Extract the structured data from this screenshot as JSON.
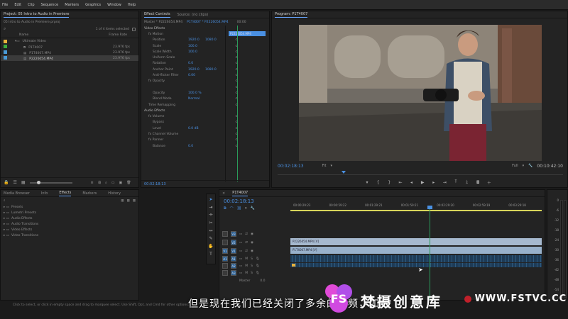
{
  "menu": [
    "File",
    "Edit",
    "Clip",
    "Sequence",
    "Markers",
    "Graphics",
    "Window",
    "Help"
  ],
  "project": {
    "title": "Project: 05 Intro to Audio in Premiere",
    "path": "05 Intro to Audio in Premiere.prproj",
    "count": "1 of 4 items selected",
    "col_name": "Name",
    "col_rate": "Frame Rate",
    "items": [
      {
        "name": "Ultimate Video",
        "rate": "",
        "color": "#e8b13a"
      },
      {
        "name": "P1T4007",
        "rate": "23.976 fps",
        "color": "#3dac3c"
      },
      {
        "name": "P1T4007.MP4",
        "rate": "23.976 fps",
        "color": "#4a9ad6"
      },
      {
        "name": "P2226054.MP4",
        "rate": "23.976 fps",
        "color": "#4a9ad6"
      }
    ]
  },
  "effects_panel": {
    "tabs": [
      "Effect Controls",
      "Source: (no clips)"
    ],
    "master": "Master * P2226054.MP4",
    "seq": "P1T4007 * P2226054.MP4",
    "timecode_top": "00:00",
    "clip_label": "P2226054.MP4",
    "sections": [
      {
        "label": "Video Effects",
        "indent": 0,
        "value": "",
        "value2": ""
      },
      {
        "label": "fx  Motion",
        "indent": 1,
        "value": "",
        "value2": ""
      },
      {
        "label": "Position",
        "indent": 2,
        "value": "1920.0",
        "value2": "1080.0"
      },
      {
        "label": "Scale",
        "indent": 2,
        "value": "100.0",
        "value2": ""
      },
      {
        "label": "Scale Width",
        "indent": 2,
        "value": "100.0",
        "value2": ""
      },
      {
        "label": "Uniform Scale",
        "indent": 2,
        "value": "",
        "value2": ""
      },
      {
        "label": "Rotation",
        "indent": 2,
        "value": "0.0",
        "value2": ""
      },
      {
        "label": "Anchor Point",
        "indent": 2,
        "value": "1920.0",
        "value2": "1080.0"
      },
      {
        "label": "Anti-flicker Filter",
        "indent": 2,
        "value": "0.00",
        "value2": ""
      },
      {
        "label": "fx  Opacity",
        "indent": 1,
        "value": "",
        "value2": ""
      },
      {
        "label": "",
        "indent": 2,
        "value": "",
        "value2": ""
      },
      {
        "label": "Opacity",
        "indent": 2,
        "value": "100.0 %",
        "value2": ""
      },
      {
        "label": "Blend Mode",
        "indent": 2,
        "value": "Normal",
        "value2": ""
      },
      {
        "label": "Time Remapping",
        "indent": 1,
        "value": "",
        "value2": ""
      },
      {
        "label": "Audio Effects",
        "indent": 0,
        "value": "",
        "value2": ""
      },
      {
        "label": "fx  Volume",
        "indent": 1,
        "value": "",
        "value2": ""
      },
      {
        "label": "Bypass",
        "indent": 2,
        "value": "",
        "value2": ""
      },
      {
        "label": "Level",
        "indent": 2,
        "value": "0.0 dB",
        "value2": ""
      },
      {
        "label": "fx  Channel Volume",
        "indent": 1,
        "value": "",
        "value2": ""
      },
      {
        "label": "fx  Panner",
        "indent": 1,
        "value": "",
        "value2": ""
      },
      {
        "label": "Balance",
        "indent": 2,
        "value": "0.0",
        "value2": ""
      }
    ],
    "footer_timecode": "00:02:18:13"
  },
  "program": {
    "title": "Program: P1T4007",
    "timecode": "00:02:18:13",
    "fit": "Fit",
    "quality": "Full",
    "duration": "00:10:42:10"
  },
  "media_browser": {
    "tabs": [
      "Media Browser",
      "Info",
      "Effects",
      "Markers",
      "History"
    ],
    "items": [
      "Presets",
      "Lumetri Presets",
      "Audio Effects",
      "Audio Transitions",
      "Video Effects",
      "Video Transitions"
    ]
  },
  "timeline": {
    "tab": "P1T4007",
    "timecode": "00:02:18:13",
    "ruler": [
      "00:00:29:23",
      "00:00:59:22",
      "00:01:29:21",
      "00:01:59:21",
      "00:02:29:20",
      "00:02:59:19",
      "00:03:29:18"
    ],
    "tracks": [
      {
        "name": "V3",
        "label": "V3"
      },
      {
        "name": "V2",
        "label": "V2"
      },
      {
        "name": "V1",
        "label": "V1"
      },
      {
        "name": "A1",
        "label": "A1"
      },
      {
        "name": "A2",
        "label": "A2"
      },
      {
        "name": "A3",
        "label": "A3"
      }
    ],
    "master": "Master",
    "master_val": "0.0",
    "clip_v2": "P2226054.MP4 [V]",
    "clip_v1": "P1T4007.MP4 [V]",
    "meter_ticks": [
      "0",
      "-6",
      "-12",
      "-18",
      "-24",
      "-30",
      "-36",
      "-42",
      "-48",
      "-54"
    ]
  },
  "status": "Click to select, or click in empty space and drag to marquee select. Use Shift, Opt, and Cmd for other options.",
  "subtitle": "但是现在我们已经关闭了多余的音频，如",
  "watermark": {
    "brand": "梵摄创意库",
    "url": "WWW.FSTVC.CC",
    "logo": "FS"
  },
  "colors": {
    "accent": "#4a90e2",
    "playhead": "#2a9c5a",
    "video_clip": "#a6b9cf",
    "audio_clip": "#345e86"
  }
}
